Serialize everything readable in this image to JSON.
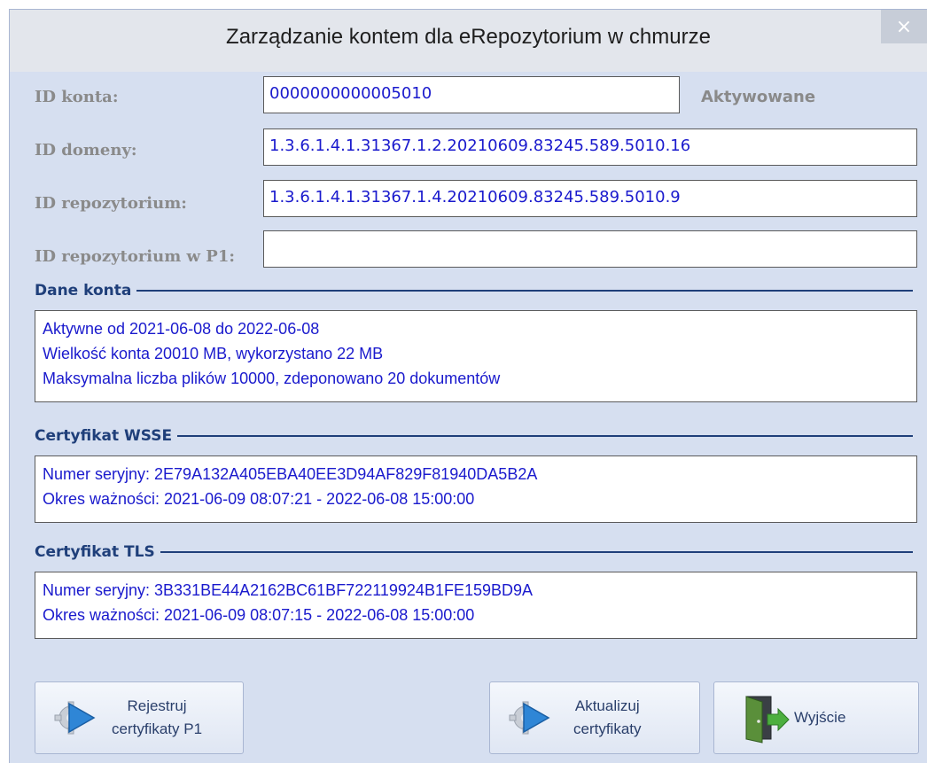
{
  "window": {
    "title": "Zarządzanie kontem dla eRepozytorium w chmurze",
    "close_glyph": "×"
  },
  "fields": {
    "account_id": {
      "label": "ID konta:",
      "value": "0000000000005010"
    },
    "status": "Aktywowane",
    "domain_id": {
      "label": "ID domeny:",
      "value": "1.3.6.1.4.1.31367.1.2.20210609.83245.589.5010.16"
    },
    "repo_id": {
      "label": "ID repozytorium:",
      "value": "1.3.6.1.4.1.31367.1.4.20210609.83245.589.5010.9"
    },
    "repo_id_p1": {
      "label": "ID repozytorium w P1:",
      "value": ""
    }
  },
  "sections": {
    "account": {
      "title": "Dane konta",
      "lines": [
        "Aktywne od 2021-06-08 do 2022-06-08",
        "Wielkość konta 20010 MB, wykorzystano 22 MB",
        "Maksymalna liczba plików 10000, zdeponowano 20 dokumentów"
      ]
    },
    "wsse": {
      "title": "Certyfikat WSSE",
      "lines": [
        "Numer seryjny: 2E79A132A405EBA40EE3D94AF829F81940DA5B2A",
        "Okres ważności: 2021-06-09 08:07:21 - 2022-06-08 15:00:00"
      ]
    },
    "tls": {
      "title": "Certyfikat TLS",
      "lines": [
        "Numer seryjny: 3B331BE44A2162BC61BF722119924B1FE159BD9A",
        "Okres ważności: 2021-06-09 08:07:15 - 2022-06-08 15:00:00"
      ]
    }
  },
  "buttons": {
    "register": {
      "line1": "Rejestruj",
      "line2": "certyfikaty P1",
      "icon": "gear-play-icon"
    },
    "update": {
      "line1": "Aktualizuj",
      "line2": "certyfikaty",
      "icon": "gear-play-icon"
    },
    "exit": {
      "label": "Wyjście",
      "icon": "door-exit-icon"
    }
  },
  "colors": {
    "accent": "#1f3f7a",
    "value_text": "#1a1acd",
    "dialog_bg": "#d6dff0"
  }
}
